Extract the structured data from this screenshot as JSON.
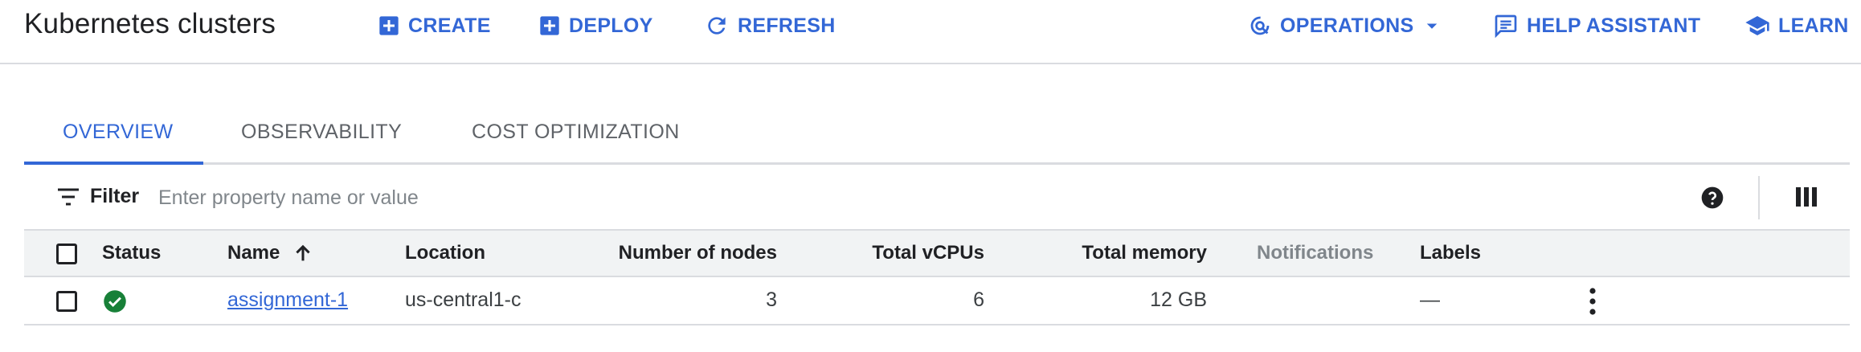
{
  "header": {
    "title": "Kubernetes clusters",
    "create_label": "CREATE",
    "deploy_label": "DEPLOY",
    "refresh_label": "REFRESH",
    "operations_label": "OPERATIONS",
    "help_assistant_label": "HELP ASSISTANT",
    "learn_label": "LEARN",
    "icons": {
      "create": "add-box-icon",
      "deploy": "add-box-icon",
      "refresh": "refresh-icon",
      "operations": "operations-icon",
      "operations_dropdown": "caret-down-icon",
      "help_assistant": "chat-icon",
      "learn": "school-icon"
    }
  },
  "tabs": [
    {
      "label": "OVERVIEW",
      "selected": true
    },
    {
      "label": "OBSERVABILITY",
      "selected": false
    },
    {
      "label": "COST OPTIMIZATION",
      "selected": false
    }
  ],
  "filter": {
    "label": "Filter",
    "placeholder": "Enter property name or value",
    "value": ""
  },
  "table": {
    "columns": [
      "Status",
      "Name",
      "Location",
      "Number of nodes",
      "Total vCPUs",
      "Total memory",
      "Notifications",
      "Labels"
    ],
    "sort": {
      "column": "Name",
      "direction": "ascending"
    },
    "rows": [
      {
        "status": "ok",
        "name": "assignment-1",
        "location": "us-central1-c",
        "nodes": "3",
        "vcpus": "6",
        "memory": "12 GB",
        "notifications": "",
        "labels": "—"
      }
    ]
  },
  "colors": {
    "accent": "#3367d6",
    "status_ok": "#188038",
    "header_bg": "#f1f3f4",
    "divider": "#dadce0"
  }
}
